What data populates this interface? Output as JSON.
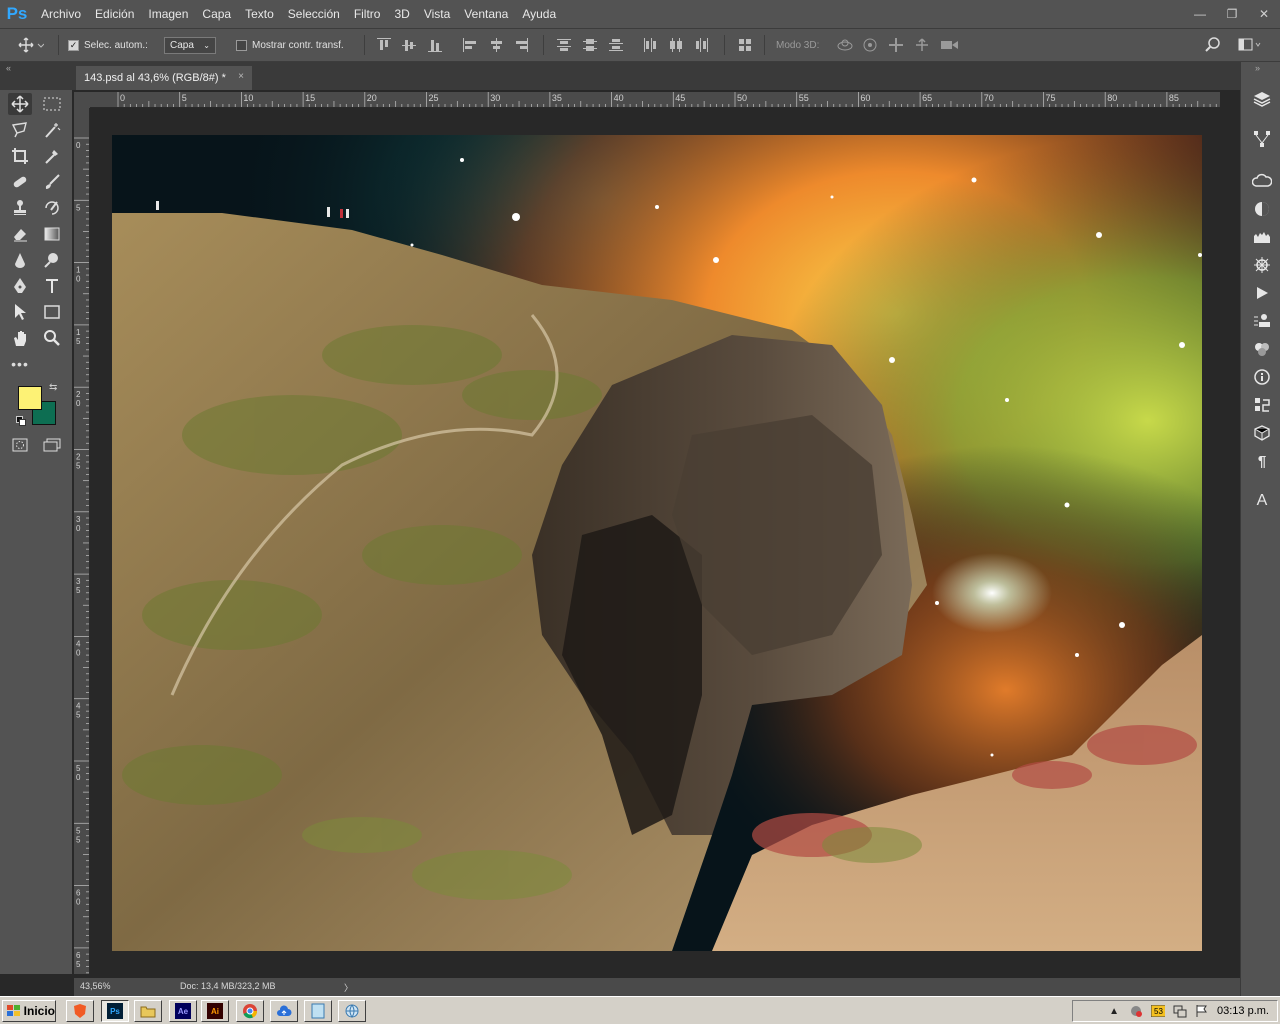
{
  "app": {
    "logo": "Ps"
  },
  "menu": [
    "Archivo",
    "Edición",
    "Imagen",
    "Capa",
    "Texto",
    "Selección",
    "Filtro",
    "3D",
    "Vista",
    "Ventana",
    "Ayuda"
  ],
  "window_controls": {
    "minimize": "—",
    "restore": "❐",
    "close": "✕"
  },
  "options": {
    "auto_select_label": "Selec. autom.:",
    "auto_select_checked": true,
    "auto_select_target": "Capa",
    "show_transform_label": "Mostrar contr. transf.",
    "show_transform_checked": false,
    "mode_3d_label": "Modo 3D:"
  },
  "tab": {
    "title": "143.psd al 43,6% (RGB/8#) *",
    "close": "×"
  },
  "ruler": {
    "top_labels": [
      "0",
      "5",
      "10",
      "15",
      "20",
      "25",
      "30",
      "35",
      "40",
      "45",
      "50",
      "55",
      "60",
      "65",
      "70",
      "75",
      "80",
      "85"
    ],
    "left_labels": [
      "0",
      "5",
      "1\n0",
      "1\n5",
      "2\n0",
      "2\n5",
      "3\n0",
      "3\n5",
      "4\n0",
      "4\n5",
      "5\n0",
      "5\n5",
      "6\n0",
      "6\n5"
    ]
  },
  "colors": {
    "foreground": "#fdf275",
    "background": "#0d6e52",
    "accent": "#31a8ff"
  },
  "status": {
    "zoom": "43,56%",
    "doc": "Doc: 13,4 MB/323,2 MB",
    "arrow": "〉"
  },
  "taskbar": {
    "start_label": "Inicio",
    "apps": [
      "brave",
      "Ps",
      "folder",
      "Ae",
      "Ai",
      "chrome",
      "cloud",
      "notes",
      "globe"
    ],
    "clock": "03:13 p.m."
  },
  "dock_icons": [
    "layers-icon",
    "paths-icon",
    "libraries-icon",
    "adjustments-icon",
    "histogram-icon",
    "navigator-icon",
    "actions-icon",
    "clone-source-icon",
    "swatches-icon",
    "info-icon",
    "history-icon",
    "3d-icon",
    "paragraph-icon",
    "character-icon"
  ],
  "tools": [
    "move-tool",
    "marquee-tool",
    "lasso-tool",
    "magic-wand-tool",
    "crop-tool",
    "eyedropper-tool",
    "healing-brush-tool",
    "brush-tool",
    "clone-stamp-tool",
    "history-brush-tool",
    "eraser-tool",
    "gradient-tool",
    "blur-tool",
    "dodge-tool",
    "pen-tool",
    "type-tool",
    "path-selection-tool",
    "rectangle-tool",
    "hand-tool",
    "zoom-tool",
    "more-tools"
  ]
}
